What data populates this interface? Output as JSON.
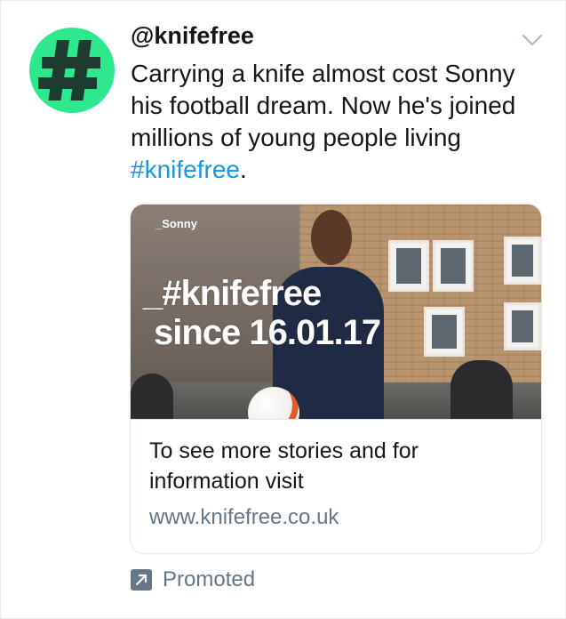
{
  "tweet": {
    "handle": "@knifefree",
    "text_before": "Carrying a knife almost cost Sonny his football dream. Now he's joined millions of young people living ",
    "hashtag": "#knifefree",
    "text_after": ".",
    "avatar_symbol": "#",
    "avatar_color": "#2ee88e",
    "menu_icon": "chevron-down-icon"
  },
  "card": {
    "image": {
      "tag": "_Sonny",
      "headline_1": "_#knifefree",
      "headline_2": "since 16.01.17"
    },
    "description": "To see more stories and for information visit",
    "url": "www.knifefree.co.uk"
  },
  "footer": {
    "promoted_label": "Promoted",
    "promoted_icon": "promoted-arrow-icon"
  },
  "colors": {
    "text": "#14171a",
    "link": "#1b95e0",
    "muted": "#657786"
  }
}
